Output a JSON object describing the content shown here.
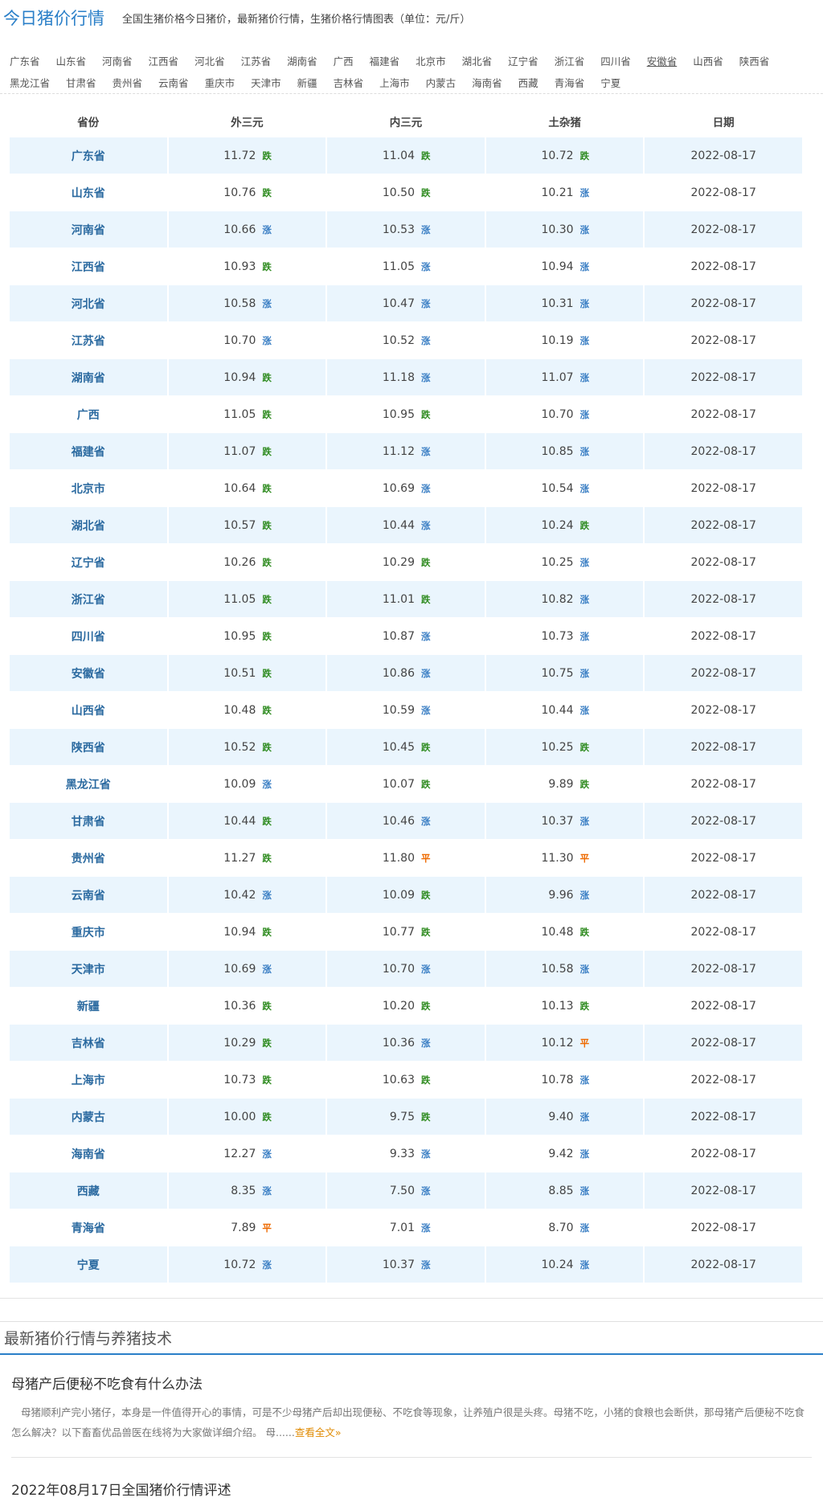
{
  "header": {
    "title": "今日猪价行情",
    "subtitle": "全国生猪价格今日猪价，最新猪价行情，生猪价格行情图表（单位：元/斤）"
  },
  "nav_rows": [
    [
      "广东省",
      "山东省",
      "河南省",
      "江西省",
      "河北省",
      "江苏省",
      "湖南省",
      "广西",
      "福建省",
      "北京市",
      "湖北省",
      "辽宁省",
      "浙江省",
      "四川省",
      "安徽省",
      "山西省",
      "陕西省"
    ],
    [
      "黑龙江省",
      "甘肃省",
      "贵州省",
      "云南省",
      "重庆市",
      "天津市",
      "新疆",
      "吉林省",
      "上海市",
      "内蒙古",
      "海南省",
      "西藏",
      "青海省",
      "宁夏"
    ]
  ],
  "nav_active": "安徽省",
  "table": {
    "headers": [
      "省份",
      "外三元",
      "内三元",
      "土杂猪",
      "日期"
    ],
    "rows": [
      [
        "广东省",
        "11.72",
        "跌",
        "11.04",
        "跌",
        "10.72",
        "跌",
        "2022-08-17"
      ],
      [
        "山东省",
        "10.76",
        "跌",
        "10.50",
        "跌",
        "10.21",
        "涨",
        "2022-08-17"
      ],
      [
        "河南省",
        "10.66",
        "涨",
        "10.53",
        "涨",
        "10.30",
        "涨",
        "2022-08-17"
      ],
      [
        "江西省",
        "10.93",
        "跌",
        "11.05",
        "涨",
        "10.94",
        "涨",
        "2022-08-17"
      ],
      [
        "河北省",
        "10.58",
        "涨",
        "10.47",
        "涨",
        "10.31",
        "涨",
        "2022-08-17"
      ],
      [
        "江苏省",
        "10.70",
        "涨",
        "10.52",
        "涨",
        "10.19",
        "涨",
        "2022-08-17"
      ],
      [
        "湖南省",
        "10.94",
        "跌",
        "11.18",
        "涨",
        "11.07",
        "涨",
        "2022-08-17"
      ],
      [
        "广西",
        "11.05",
        "跌",
        "10.95",
        "跌",
        "10.70",
        "涨",
        "2022-08-17"
      ],
      [
        "福建省",
        "11.07",
        "跌",
        "11.12",
        "涨",
        "10.85",
        "涨",
        "2022-08-17"
      ],
      [
        "北京市",
        "10.64",
        "跌",
        "10.69",
        "涨",
        "10.54",
        "涨",
        "2022-08-17"
      ],
      [
        "湖北省",
        "10.57",
        "跌",
        "10.44",
        "涨",
        "10.24",
        "跌",
        "2022-08-17"
      ],
      [
        "辽宁省",
        "10.26",
        "跌",
        "10.29",
        "跌",
        "10.25",
        "涨",
        "2022-08-17"
      ],
      [
        "浙江省",
        "11.05",
        "跌",
        "11.01",
        "跌",
        "10.82",
        "涨",
        "2022-08-17"
      ],
      [
        "四川省",
        "10.95",
        "跌",
        "10.87",
        "涨",
        "10.73",
        "涨",
        "2022-08-17"
      ],
      [
        "安徽省",
        "10.51",
        "跌",
        "10.86",
        "涨",
        "10.75",
        "涨",
        "2022-08-17"
      ],
      [
        "山西省",
        "10.48",
        "跌",
        "10.59",
        "涨",
        "10.44",
        "涨",
        "2022-08-17"
      ],
      [
        "陕西省",
        "10.52",
        "跌",
        "10.45",
        "跌",
        "10.25",
        "跌",
        "2022-08-17"
      ],
      [
        "黑龙江省",
        "10.09",
        "涨",
        "10.07",
        "跌",
        "9.89",
        "跌",
        "2022-08-17"
      ],
      [
        "甘肃省",
        "10.44",
        "跌",
        "10.46",
        "涨",
        "10.37",
        "涨",
        "2022-08-17"
      ],
      [
        "贵州省",
        "11.27",
        "跌",
        "11.80",
        "平",
        "11.30",
        "平",
        "2022-08-17"
      ],
      [
        "云南省",
        "10.42",
        "涨",
        "10.09",
        "跌",
        "9.96",
        "涨",
        "2022-08-17"
      ],
      [
        "重庆市",
        "10.94",
        "跌",
        "10.77",
        "跌",
        "10.48",
        "跌",
        "2022-08-17"
      ],
      [
        "天津市",
        "10.69",
        "涨",
        "10.70",
        "涨",
        "10.58",
        "涨",
        "2022-08-17"
      ],
      [
        "新疆",
        "10.36",
        "跌",
        "10.20",
        "跌",
        "10.13",
        "跌",
        "2022-08-17"
      ],
      [
        "吉林省",
        "10.29",
        "跌",
        "10.36",
        "涨",
        "10.12",
        "平",
        "2022-08-17"
      ],
      [
        "上海市",
        "10.73",
        "跌",
        "10.63",
        "跌",
        "10.78",
        "涨",
        "2022-08-17"
      ],
      [
        "内蒙古",
        "10.00",
        "跌",
        "9.75",
        "跌",
        "9.40",
        "涨",
        "2022-08-17"
      ],
      [
        "海南省",
        "12.27",
        "涨",
        "9.33",
        "涨",
        "9.42",
        "涨",
        "2022-08-17"
      ],
      [
        "西藏",
        "8.35",
        "涨",
        "7.50",
        "涨",
        "8.85",
        "涨",
        "2022-08-17"
      ],
      [
        "青海省",
        "7.89",
        "平",
        "7.01",
        "涨",
        "8.70",
        "涨",
        "2022-08-17"
      ],
      [
        "宁夏",
        "10.72",
        "涨",
        "10.37",
        "涨",
        "10.24",
        "涨",
        "2022-08-17"
      ]
    ]
  },
  "trend_colors": {
    "跌": "#2e8b1f",
    "涨": "#3b7fc4",
    "平": "#ee6a00"
  },
  "news": {
    "section_title": "最新猪价行情与养猪技术",
    "item1": {
      "title": "母猪产后便秘不吃食有什么办法",
      "text": "母猪顺利产完小猪仔，本身是一件值得开心的事情，可是不少母猪产后却出现便秘、不吃食等现象，让养殖户很是头疼。母猪不吃，小猪的食粮也会断供，那母猪产后便秘不吃食怎么解决？以下畜畜优品兽医在线将为大家做详细介绍。 母......",
      "more": "查看全文»"
    },
    "item2": {
      "title": "2022年08月17日全国猪价行情评述"
    }
  }
}
